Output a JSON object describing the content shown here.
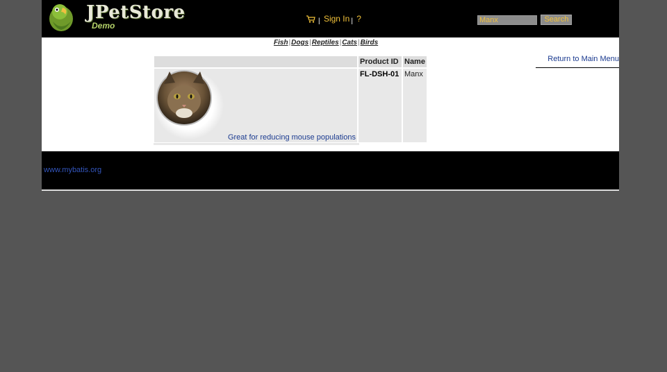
{
  "header": {
    "logo_title": "JPetStore",
    "logo_subtitle": "Demo",
    "menu": {
      "sign_in_label": "Sign In",
      "help_label": "?",
      "separator": "|"
    },
    "search": {
      "value": "Manx",
      "button_label": "Search"
    }
  },
  "quick_links": {
    "items": [
      "Fish",
      "Dogs",
      "Reptiles",
      "Cats",
      "Birds"
    ],
    "separator": "|"
  },
  "return_link": "Return to Main Menu",
  "item_table": {
    "headers": [
      "Product ID",
      "Name"
    ],
    "rows": [
      {
        "description": "Great for reducing mouse populations",
        "product_id": "FL-DSH-01",
        "name": "Manx"
      }
    ]
  },
  "footer": {
    "link": "www.mybatis.org"
  },
  "colors": {
    "header_bg": "#000000",
    "link_accent": "#f2c23a",
    "page_bg": "#555555"
  }
}
